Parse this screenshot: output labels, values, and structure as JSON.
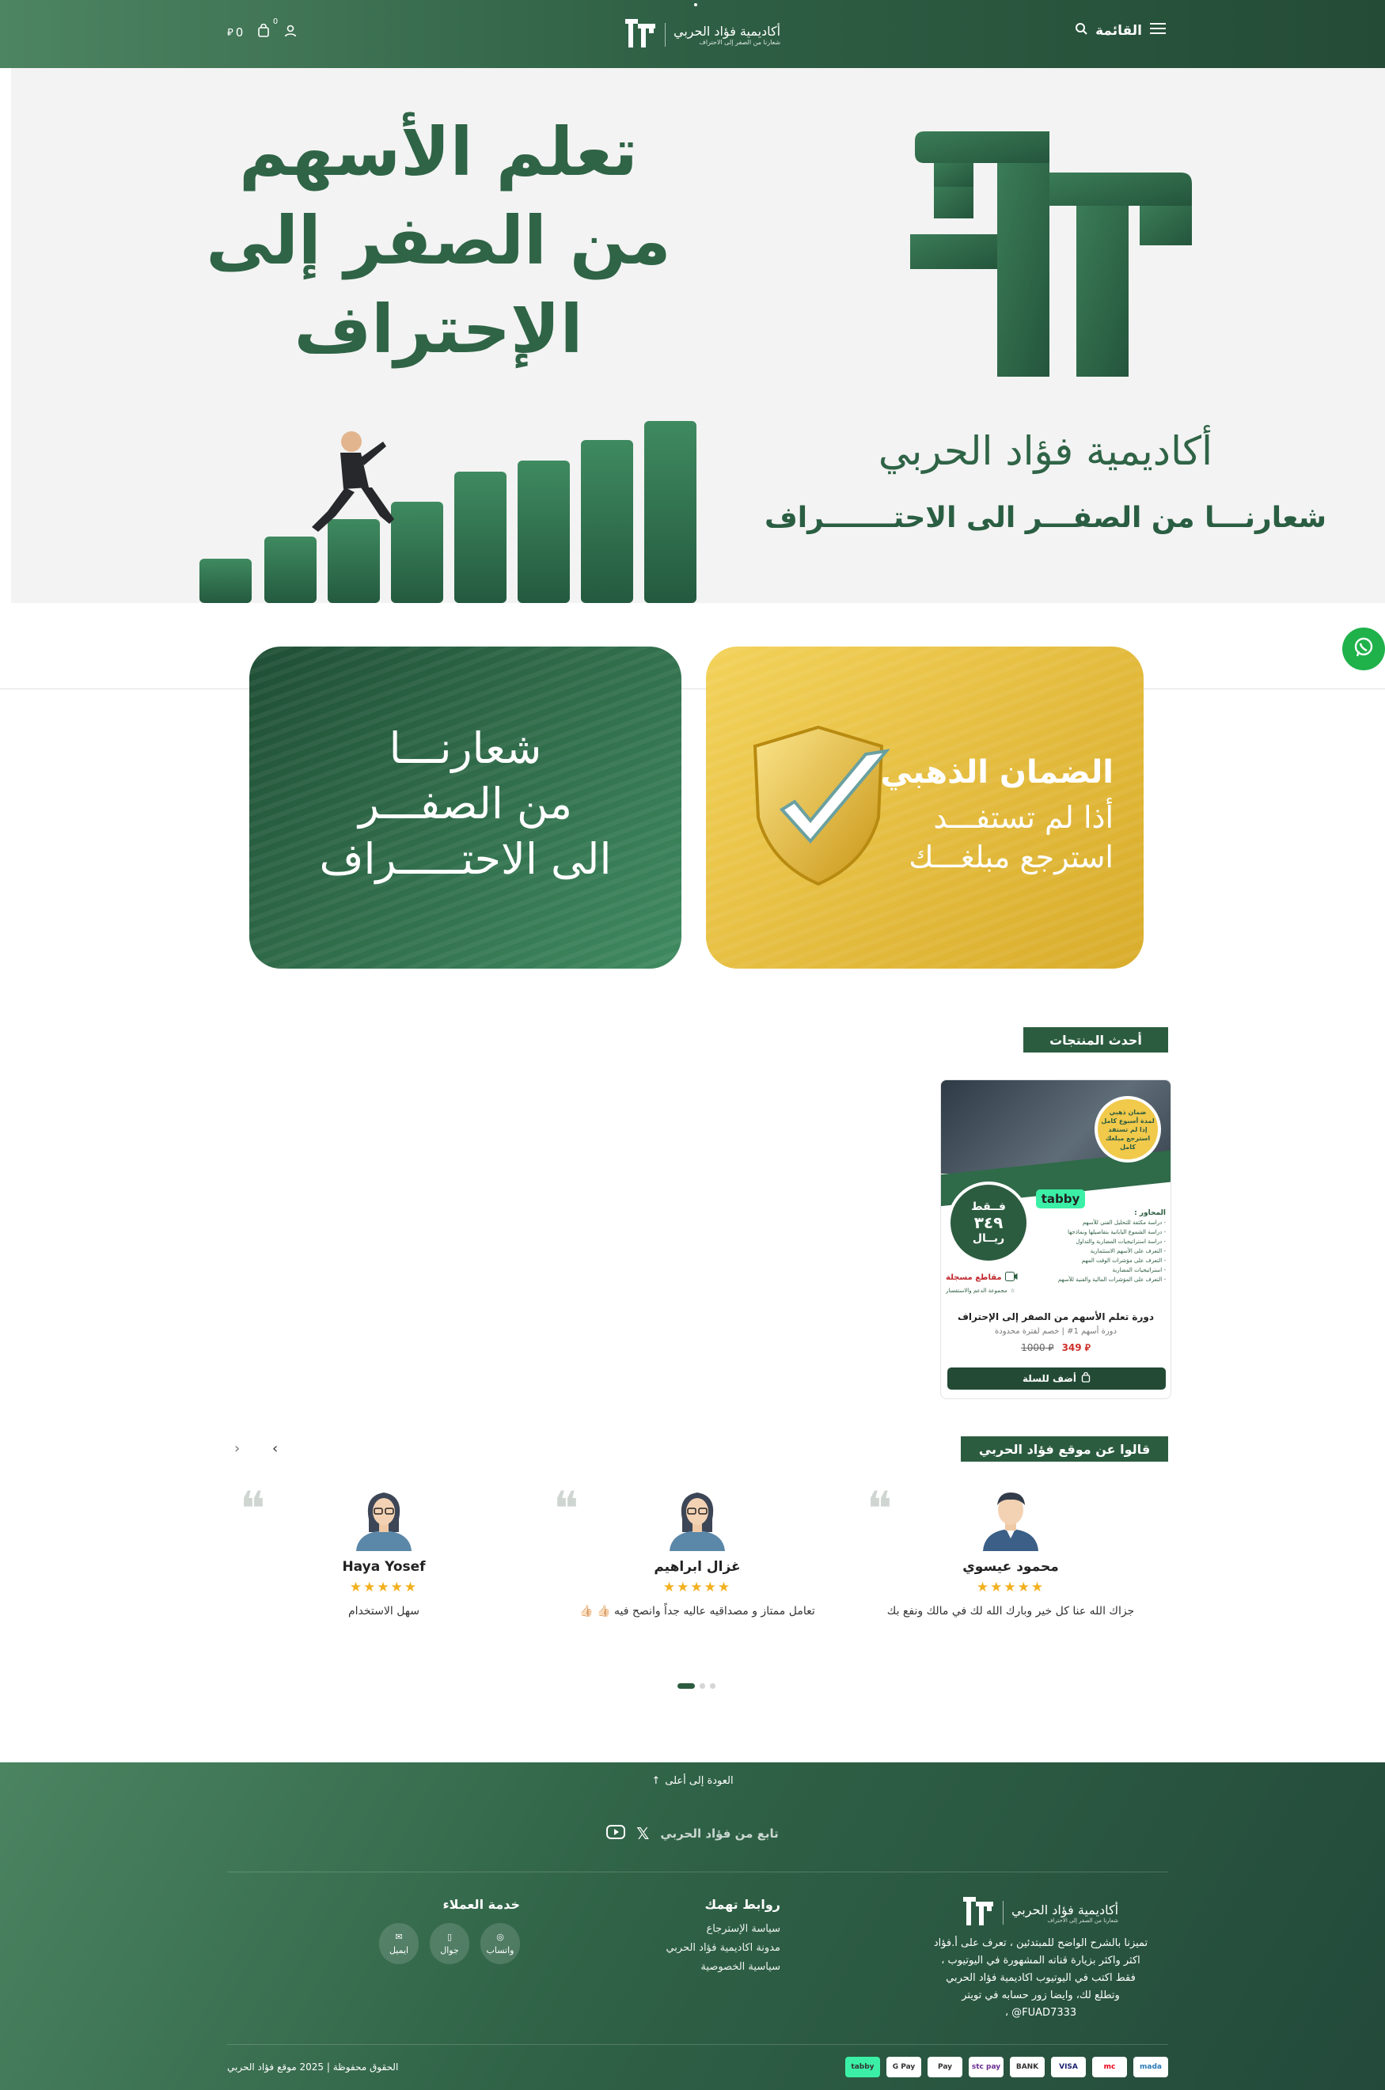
{
  "header": {
    "menu_label": "القائمة",
    "logo_name": "أكاديمية فؤاد الحربي",
    "logo_tagline": "شعارنا من الصفر إلى الاحتراف",
    "cart_amount": "0",
    "cart_badge": "0"
  },
  "hero": {
    "title_line1": "تعلم الأسهم",
    "title_line2": "من الصفر إلى الإحتراف",
    "academy": "أكاديمية فؤاد الحربي",
    "slogan": "شعارنـــا من الصفـــر الى الاحتـــــــراف"
  },
  "banners": {
    "green": {
      "line1": "شعارنـــا",
      "line2": "من الصفـــر",
      "line3": "الى الاحتـــــراف"
    },
    "gold": {
      "title": "الضمان الذهبي",
      "line1": "أذا لم تستفـــد",
      "line2": "استرجع مبلغـــك"
    }
  },
  "latest": {
    "title": "أحدث المنتجات",
    "product": {
      "name": "دورة تعلم الأسهم من الصفر إلى الإحتراف",
      "subtitle": "دورة أسهم 1# | خصم لفترة محدودة",
      "price": "349",
      "old_price": "1000",
      "add_to_cart": "أضف للسلة",
      "image": {
        "badge_line1": "ضمان ذهبي",
        "badge_line2": "لمدة أسبوع كامل",
        "badge_line3": "إذا لم تستفد",
        "badge_line4": "استرجع مبلغك",
        "badge_line5": "كامل",
        "tabby": "tabby",
        "only": "فــقط",
        "price_ar": "٣٤٩",
        "currency": "ريــال",
        "axes_title": "المحاور :",
        "axes": [
          "- دراسة مكثفة للتحليل الفني للأسهم",
          "- دراسة الشموع اليابانية بتفاصيلها ونماذجها",
          "- دراسة استراتيجيات المضاربة والتداول",
          "- التعرف على الأسهم الاستثمارية",
          "- التعرف على مؤشرات الوقت المهم",
          "- استراتيجيات المضاربة",
          "- التعرف على المؤشرات المالية والفنية للأسهم"
        ],
        "recorded": "مقاطع مسجلة",
        "support": "مجموعة الدعم والاستفسار"
      }
    }
  },
  "testimonials": {
    "title": "قالوا عن موقع فؤاد الحربي",
    "items": [
      {
        "name": "محمود عيسوي",
        "stars": "★★★★★",
        "comment": "جزاك الله عنا كل خير وبارك الله لك في مالك ونفع بك"
      },
      {
        "name": "غزال ابراهيم",
        "stars": "★★★★★",
        "comment": "تعامل ممتاز و مصداقيه عاليه جداً وانصح فيه 👍🏻 👍🏻"
      },
      {
        "name": "Haya Yosef",
        "stars": "★★★★★",
        "comment": "سهل الاستخدام"
      }
    ]
  },
  "footer": {
    "back_to_top": "العودة إلى أعلى",
    "follow": "تابع من فؤاد الحربي",
    "brand_name": "أكاديمية فؤاد الحربي",
    "brand_tagline": "شعارنا من الصفر إلى الاحتراف",
    "about_lines": [
      "تميزنا بالشرح الواضح للمبتدئين ، تعرف على أ.فؤاد",
      "اكثر واكثر بزيارة قناته المشهورة في اليوتيوب ،",
      "فقط اكتب في اليوتيوب اكاديمية فؤاد الحربي",
      "وتطلع لك، وايضا زور حسابه في تويتر",
      "FUAD7333@ ،"
    ],
    "links_title": "روابط تهمك",
    "links": [
      "سياسة الإسترجاع",
      "مدونة اكاديمية فؤاد الحربي",
      "سياسية الخصوصية"
    ],
    "service_title": "خدمة العملاء",
    "service": [
      "واتساب",
      "جوال",
      "ايميل"
    ],
    "copyright": "الحقوق محفوظة | 2025 موقع فؤاد الحربي",
    "payments": [
      "tabby",
      "G Pay",
      "Pay",
      "stc pay",
      "BANK",
      "VISA",
      "mc",
      "mada"
    ]
  },
  "colors": {
    "primary": "#2c5c40",
    "gold": "#e2b93b",
    "star": "#f2b01e",
    "sale": "#d0312d"
  }
}
